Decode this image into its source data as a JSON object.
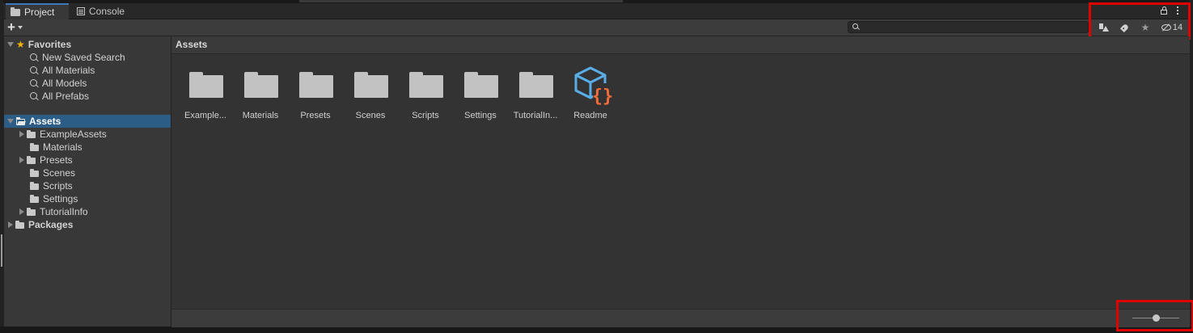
{
  "tabs": [
    {
      "label": "Project",
      "icon": "folder-icon",
      "active": true
    },
    {
      "label": "Console",
      "icon": "console-icon",
      "active": false
    }
  ],
  "search": {
    "placeholder": "",
    "value": ""
  },
  "toolbar": {
    "hidden_packages_count": "14"
  },
  "favorites": {
    "label": "Favorites",
    "items": [
      "New Saved Search",
      "All Materials",
      "All Models",
      "All Prefabs"
    ]
  },
  "tree": {
    "assets_label": "Assets",
    "children": [
      {
        "label": "ExampleAssets",
        "expandable": true
      },
      {
        "label": "Materials",
        "expandable": false
      },
      {
        "label": "Presets",
        "expandable": true
      },
      {
        "label": "Scenes",
        "expandable": false
      },
      {
        "label": "Scripts",
        "expandable": false
      },
      {
        "label": "Settings",
        "expandable": false
      },
      {
        "label": "TutorialInfo",
        "expandable": true
      }
    ],
    "packages_label": "Packages"
  },
  "breadcrumb": {
    "label": "Assets"
  },
  "assets": [
    {
      "label": "Example...",
      "kind": "folder"
    },
    {
      "label": "Materials",
      "kind": "folder"
    },
    {
      "label": "Presets",
      "kind": "folder"
    },
    {
      "label": "Scenes",
      "kind": "folder"
    },
    {
      "label": "Scripts",
      "kind": "folder"
    },
    {
      "label": "Settings",
      "kind": "folder"
    },
    {
      "label": "TutorialIn...",
      "kind": "folder"
    },
    {
      "label": "Readme",
      "kind": "readme"
    }
  ],
  "colors": {
    "selection": "#2c5d87",
    "highlight": "#e10000",
    "readme_cube": "#5aaee8",
    "readme_braces": "#f26b3a",
    "favorite_star": "#f2b40b"
  }
}
